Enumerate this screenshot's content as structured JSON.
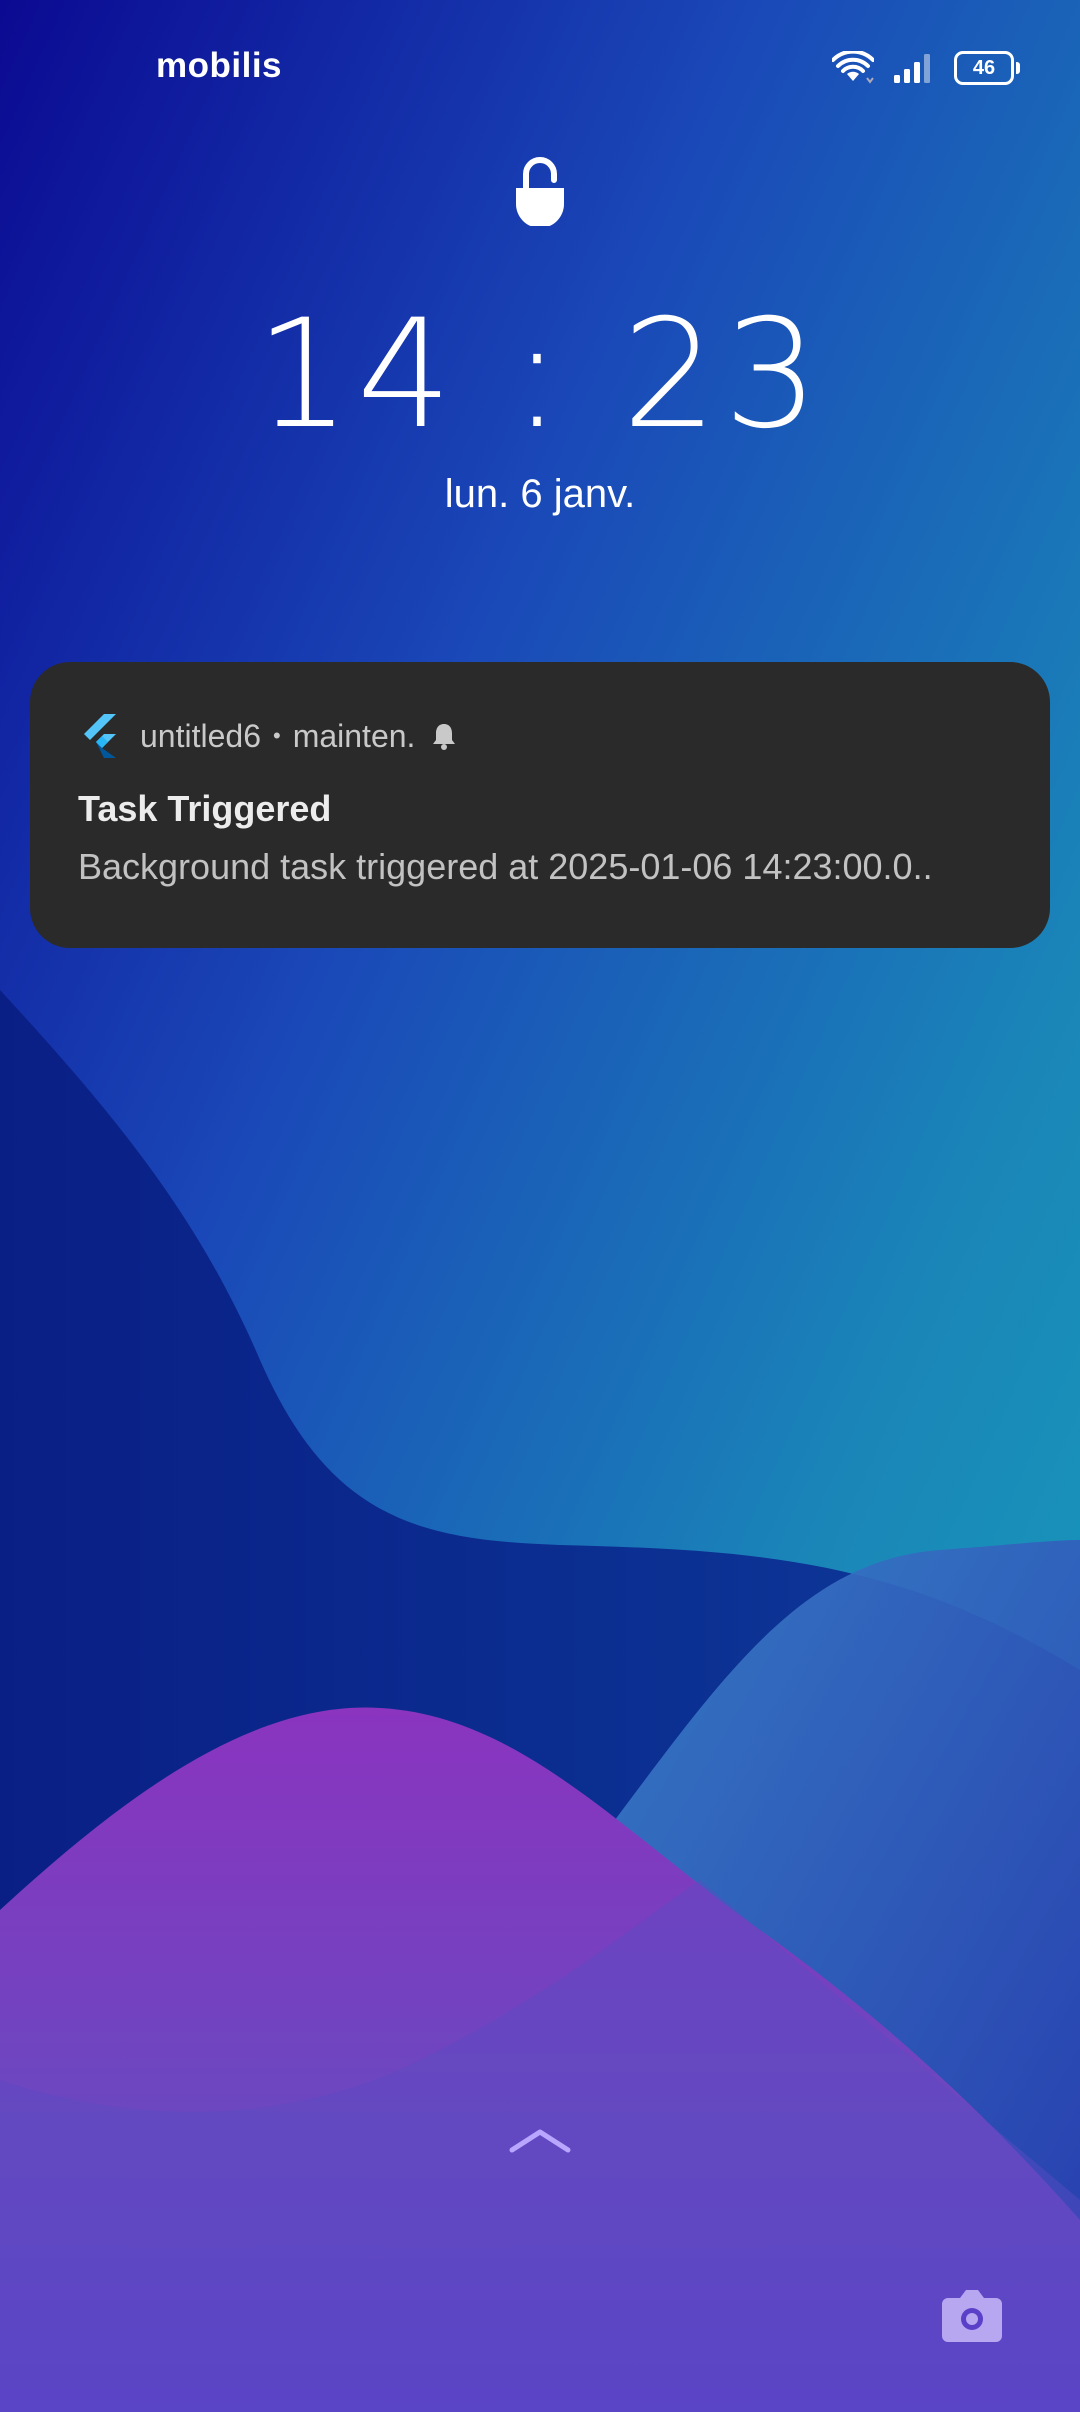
{
  "status_bar": {
    "carrier": "mobilis",
    "battery_level": "46",
    "wifi_icon": "wifi-icon",
    "signal_icon": "signal-icon"
  },
  "lock_screen": {
    "lock_icon": "lock-open-icon",
    "time": "14 : 23",
    "date": "lun. 6 janv."
  },
  "notification": {
    "app_icon": "flutter-icon",
    "app_name": "untitled6",
    "separator": "•",
    "channel": "mainten.",
    "alert_icon": "bell-icon",
    "title": "Task Triggered",
    "body": "Background task triggered at 2025-01-06 14:23:00.0.."
  },
  "bottom": {
    "swipe_icon": "chevron-up-icon",
    "camera_icon": "camera-icon"
  },
  "colors": {
    "notification_bg": "#2a2a2a",
    "wallpaper_deep_blue": "#0a0a8f",
    "wallpaper_teal": "#1b8fb8",
    "wallpaper_purple": "#8a3cc0"
  }
}
